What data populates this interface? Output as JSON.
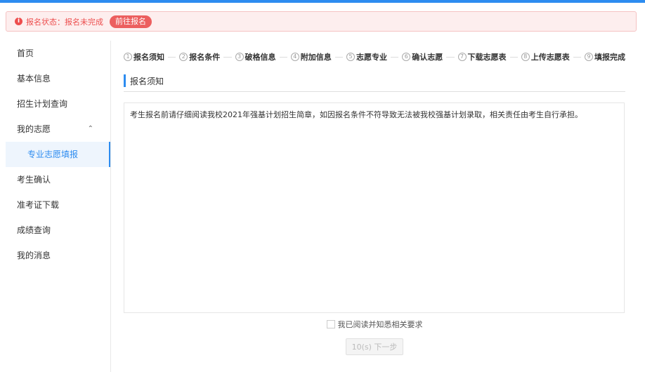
{
  "alert": {
    "label": "报名状态：",
    "value": "报名未完成",
    "button": "前往报名"
  },
  "sidebar": {
    "items": [
      {
        "label": "首页"
      },
      {
        "label": "基本信息"
      },
      {
        "label": "招生计划查询"
      },
      {
        "label": "我的志愿"
      },
      {
        "label": "专业志愿填报"
      },
      {
        "label": "考生确认"
      },
      {
        "label": "准考证下载"
      },
      {
        "label": "成绩查询"
      },
      {
        "label": "我的消息"
      }
    ]
  },
  "steps": [
    {
      "num": "1",
      "label": "报名须知"
    },
    {
      "num": "2",
      "label": "报名条件"
    },
    {
      "num": "3",
      "label": "破格信息"
    },
    {
      "num": "4",
      "label": "附加信息"
    },
    {
      "num": "5",
      "label": "志愿专业"
    },
    {
      "num": "6",
      "label": "确认志愿"
    },
    {
      "num": "7",
      "label": "下载志愿表"
    },
    {
      "num": "8",
      "label": "上传志愿表"
    },
    {
      "num": "9",
      "label": "填报完成"
    }
  ],
  "section": {
    "title": "报名须知"
  },
  "notice": {
    "text": "考生报名前请仔细阅读我校2021年强基计划招生简章，如因报名条件不符导致无法被我校强基计划录取，相关责任由考生自行承担。"
  },
  "agree": {
    "label": "我已阅读并知悉相关要求"
  },
  "next": {
    "label": "10(s) 下一步"
  },
  "colors": {
    "accent": "#2d8cf0",
    "alert": "#ed4d4d"
  }
}
